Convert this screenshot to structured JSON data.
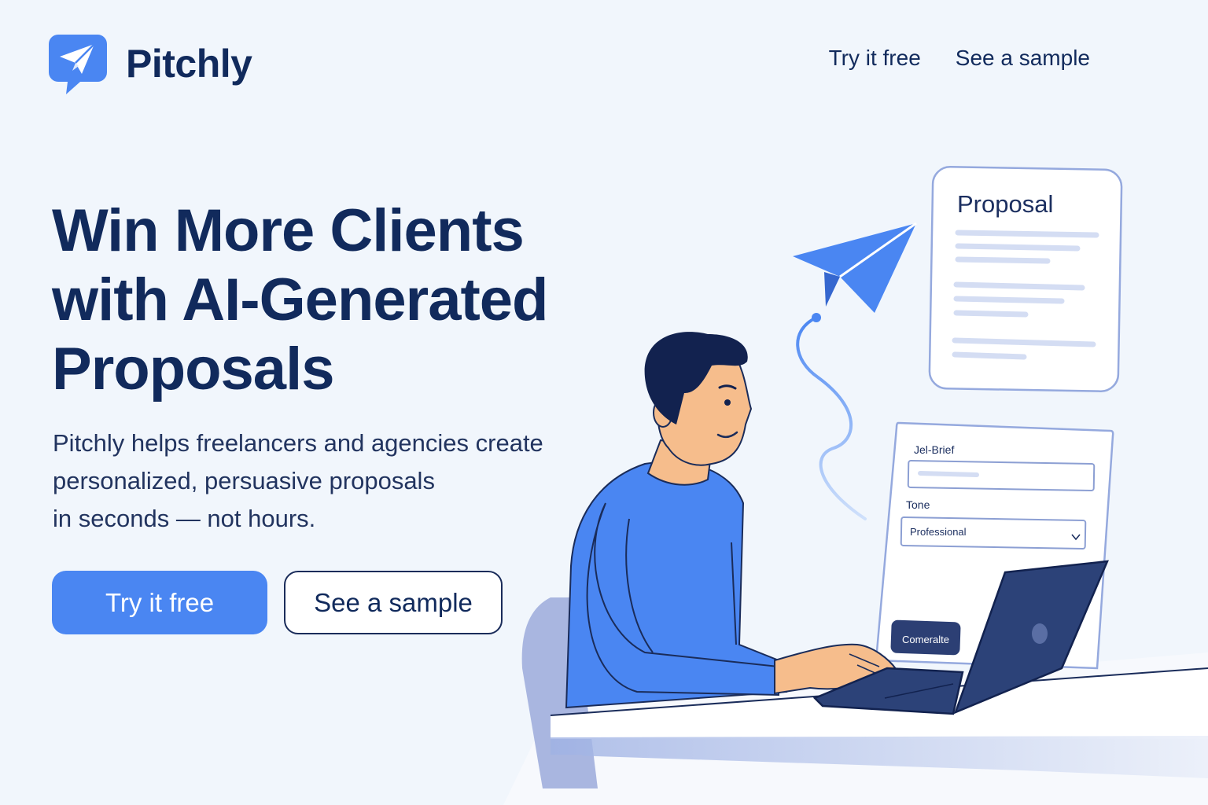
{
  "brand": {
    "name": "Pitchly",
    "logo_icon": "paper-plane-chat-icon"
  },
  "nav": {
    "try_label": "Try it free",
    "sample_label": "See a sample"
  },
  "hero": {
    "headline_lines": [
      "Win More Clients",
      "with AI-Generated",
      "Proposals"
    ],
    "subtext_lines": [
      "Pitchly helps freelancers and agencies create",
      "personalized, persuasive proposals",
      "in seconds — not hours."
    ],
    "cta_primary": "Try it free",
    "cta_secondary": "See a sample"
  },
  "illustration": {
    "proposal_card_title": "Proposal",
    "form": {
      "brief_label": "Jel-Brief",
      "tone_label": "Tone",
      "tone_value": "Professional",
      "generate_label": "Comeralte"
    }
  },
  "colors": {
    "background": "#f1f6fc",
    "navy": "#112a5c",
    "accent_blue": "#4a86f2",
    "laptop": "#2c4278"
  }
}
